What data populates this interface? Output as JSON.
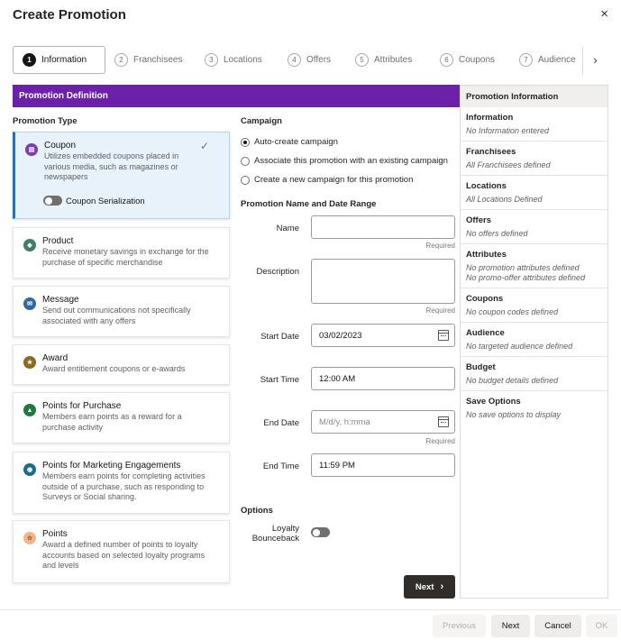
{
  "dialog": {
    "title": "Create Promotion",
    "close_glyph": "×"
  },
  "train": {
    "steps": [
      {
        "num": "1",
        "label": "Information",
        "active": true
      },
      {
        "num": "2",
        "label": "Franchisees"
      },
      {
        "num": "3",
        "label": "Locations"
      },
      {
        "num": "4",
        "label": "Offers"
      },
      {
        "num": "5",
        "label": "Attributes"
      },
      {
        "num": "6",
        "label": "Coupons"
      },
      {
        "num": "7",
        "label": "Audience"
      }
    ],
    "next_glyph": "›"
  },
  "definition": {
    "header": "Promotion Definition",
    "promotion_type_label": "Promotion Type",
    "types": [
      {
        "title": "Coupon",
        "desc": "Utilizes embedded coupons placed in various media, such as magazines or newspapers",
        "icon": "coupon-icon",
        "color": "#7b3fb5"
      },
      {
        "title": "Product",
        "desc": "Receive monetary savings in exchange for the purchase of specific merchandise",
        "icon": "product-icon",
        "color": "#3f7f6a"
      },
      {
        "title": "Message",
        "desc": "Send out communications not specifically associated with any offers",
        "icon": "message-icon",
        "color": "#2f6aa3"
      },
      {
        "title": "Award",
        "desc": "Award entitlement coupons or e-awards",
        "icon": "award-icon",
        "color": "#8a6a1f"
      },
      {
        "title": "Points for Purchase",
        "desc": "Members earn points as a reward for a purchase activity",
        "icon": "points-purchase-icon",
        "color": "#1f7a3f"
      },
      {
        "title": "Points for Marketing Engagements",
        "desc": "Members earn points for completing activities outside of a purchase, such as responding to Surveys or Social sharing.",
        "icon": "points-engagement-icon",
        "color": "#1f6a8a"
      },
      {
        "title": "Points",
        "desc": "Award a defined number of points to loyalty accounts based on selected loyalty programs and levels",
        "icon": "points-icon",
        "color": "#f2b48a"
      }
    ],
    "coupon_serialization_label": "Coupon Serialization",
    "check_glyph": "✓"
  },
  "campaign": {
    "label": "Campaign",
    "options": [
      {
        "label": "Auto-create campaign",
        "selected": true
      },
      {
        "label": "Associate this promotion with an existing campaign"
      },
      {
        "label": "Create a new campaign for this promotion"
      }
    ]
  },
  "name_date": {
    "label": "Promotion Name and Date Range",
    "name_label": "Name",
    "name_value": "",
    "description_label": "Description",
    "description_value": "",
    "required_text": "Required",
    "start_date_label": "Start Date",
    "start_date_value": "03/02/2023",
    "start_time_label": "Start Time",
    "start_time_value": "12:00 AM",
    "end_date_label": "End Date",
    "end_date_placeholder": "M/d/y, h:mma",
    "end_time_label": "End Time",
    "end_time_value": "11:59 PM"
  },
  "options": {
    "label": "Options",
    "loyalty_label_1": "Loyalty",
    "loyalty_label_2": "Bounceback"
  },
  "next_button": {
    "label": "Next",
    "glyph": "›"
  },
  "info_panel": {
    "header": "Promotion Information",
    "items": [
      {
        "title": "Information",
        "values": [
          "No Information entered"
        ]
      },
      {
        "title": "Franchisees",
        "values": [
          "All Franchisees defined"
        ]
      },
      {
        "title": "Locations",
        "values": [
          "All Locations Defined"
        ]
      },
      {
        "title": "Offers",
        "values": [
          "No offers defined"
        ]
      },
      {
        "title": "Attributes",
        "values": [
          "No promotion attributes defined",
          "No promo-offer attributes defined"
        ]
      },
      {
        "title": "Coupons",
        "values": [
          "No coupon codes defined"
        ]
      },
      {
        "title": "Audience",
        "values": [
          "No targeted audience defined"
        ]
      },
      {
        "title": "Budget",
        "values": [
          "No budget details defined"
        ]
      },
      {
        "title": "Save Options",
        "values": [
          "No save options to display"
        ]
      }
    ]
  },
  "footer": {
    "previous": "Previous",
    "next": "Next",
    "cancel": "Cancel",
    "ok": "OK"
  }
}
